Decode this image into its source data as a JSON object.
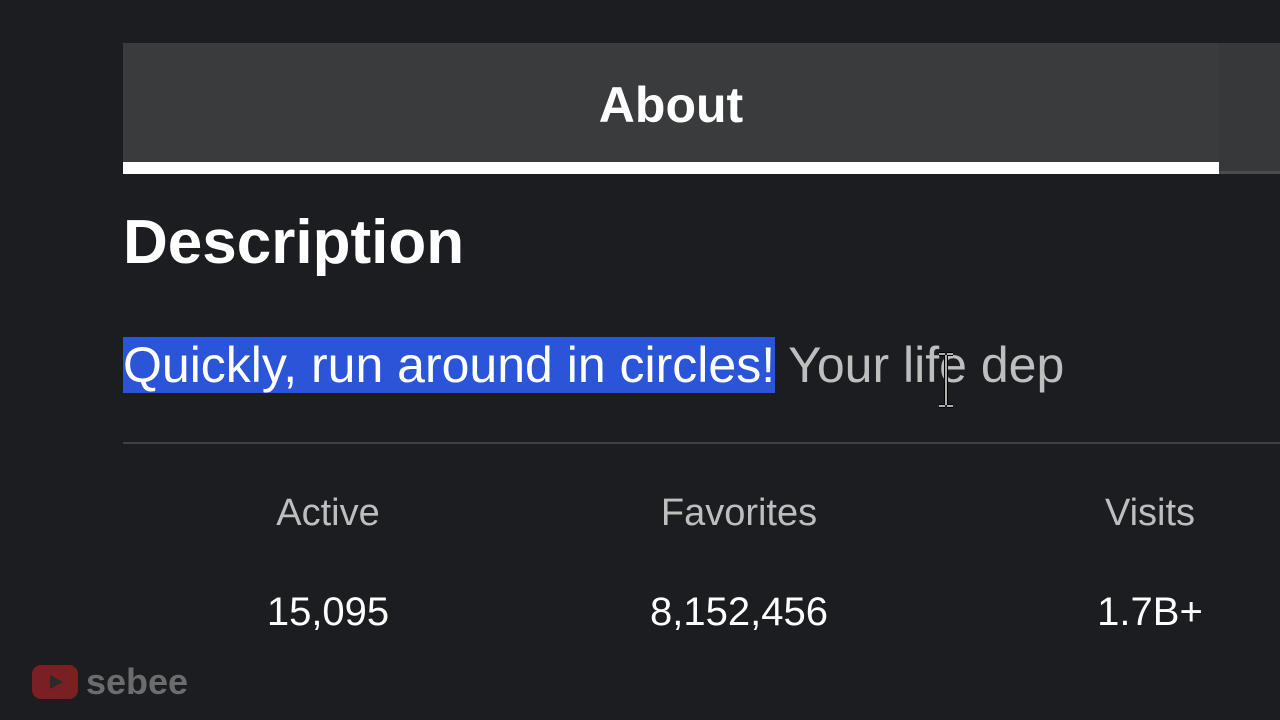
{
  "tabs": {
    "active_label": "About"
  },
  "description": {
    "heading": "Description",
    "selected_text": "Quickly, run around in circles!",
    "remaining_text": " Your life dep"
  },
  "stats": {
    "active": {
      "label": "Active",
      "value": "15,095"
    },
    "favorites": {
      "label": "Favorites",
      "value": "8,152,456"
    },
    "visits": {
      "label": "Visits",
      "value": "1.7B+"
    }
  },
  "watermark": {
    "channel": "sebee",
    "icon": "youtube-icon"
  },
  "colors": {
    "background": "#1c1d20",
    "tab_bar": "#393b3d",
    "selection": "#2b55d8",
    "secondary_text": "#bdbebe"
  }
}
